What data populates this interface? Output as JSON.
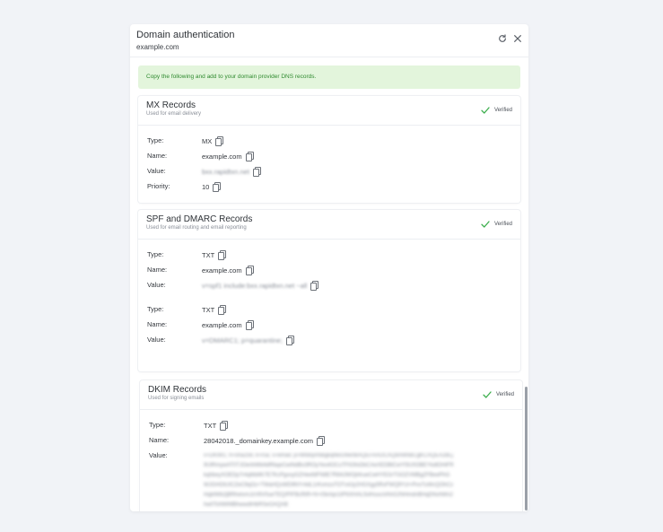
{
  "modal": {
    "title": "Domain authentication",
    "subtitle": "example.com",
    "refresh_icon": "refresh-icon",
    "close_icon": "close-icon"
  },
  "banner": {
    "text": "Copy the following and add to your domain provider DNS records."
  },
  "verified_label": "Verified",
  "accent_green": "#3cae4c",
  "mx": {
    "title": "MX Records",
    "subtitle": "Used for email delivery",
    "type_label": "Type:",
    "type": "MX",
    "name_label": "Name:",
    "name": "example.com",
    "value_label": "Value:",
    "value": "bxx.rapidtxn.net",
    "priority_label": "Priority:",
    "priority": "10"
  },
  "spf": {
    "title": "SPF and DMARC Records",
    "subtitle": "Used for email routing and email reporting",
    "records": [
      {
        "type_label": "Type:",
        "type": "TXT",
        "name_label": "Name:",
        "name": "example.com",
        "value_label": "Value:",
        "value": "v=spf1 include:bxx.rapidtxn.net ~all"
      },
      {
        "type_label": "Type:",
        "type": "TXT",
        "name_label": "Name:",
        "name": "example.com",
        "value_label": "Value:",
        "value": "v=DMARC1; p=quarantine;"
      }
    ]
  },
  "dkim": {
    "title": "DKIM Records",
    "subtitle": "Used for signing emails",
    "type_label": "Type:",
    "type": "TXT",
    "name_label": "Name:",
    "name": "28042018._domainkey.example.com",
    "value_label": "Value:",
    "value": "v=DKIM1; h=sha256; k=rsa; s=email; p=MIIBIjANBgkqhkiG9w0BAQEFAAOCAQ8AMIIBCgKCAQEA2BLj9UlRmywAT0TJOerbWbl4dRbqeCwiNdBo3ROyYeo4OCuTFtG9sDbCAeXEDBlCwYf3U0OBEYkdlOHiFRkqhbeyXOEDp7r4qMd4K7E7KcPgxxyGZHeefdFN8E7R84JWOjI4rueCwHYEGrTGOZVMBgZFBeePhGWJGHOtUICZeC9qOz+TWaHQsWD9NYr4dL1rKvmzoTOTx4Jy2HGXgy5RxFWQ9YzI+PnxTuWcQOhCzHqbIWb2jBRhetvmJzV6V0ueTEQ/PIFBcRtR+N+iSkrIqn1tPNXHAL5vlHuxuVAhG2NHmdnBHqDNvhWn2hw0ToNWMBhwwdIHbRSeOAQAB"
  }
}
